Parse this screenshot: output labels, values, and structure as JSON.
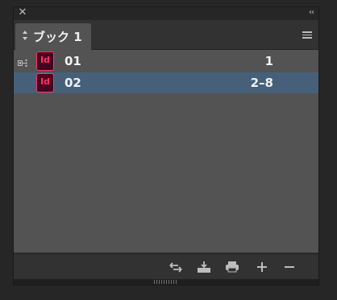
{
  "window": {
    "close_symbol": "✕",
    "collapse_symbol": "‹‹"
  },
  "tab": {
    "title": "ブック 1",
    "arrows_symbol": "▲▼"
  },
  "documents": [
    {
      "name": "01",
      "pages": "1",
      "icon": "indesign-document-icon",
      "status": "style-source-icon"
    },
    {
      "name": "02",
      "pages": "2–8",
      "icon": "indesign-document-icon",
      "selected": true
    }
  ],
  "icon_label": "Id",
  "toolbar": {
    "items": [
      "synchronize-icon",
      "add-document-download-icon",
      "print-icon",
      "add-icon",
      "remove-icon"
    ]
  },
  "colors": {
    "accent": "#ff3366",
    "selection": "#46607a"
  }
}
